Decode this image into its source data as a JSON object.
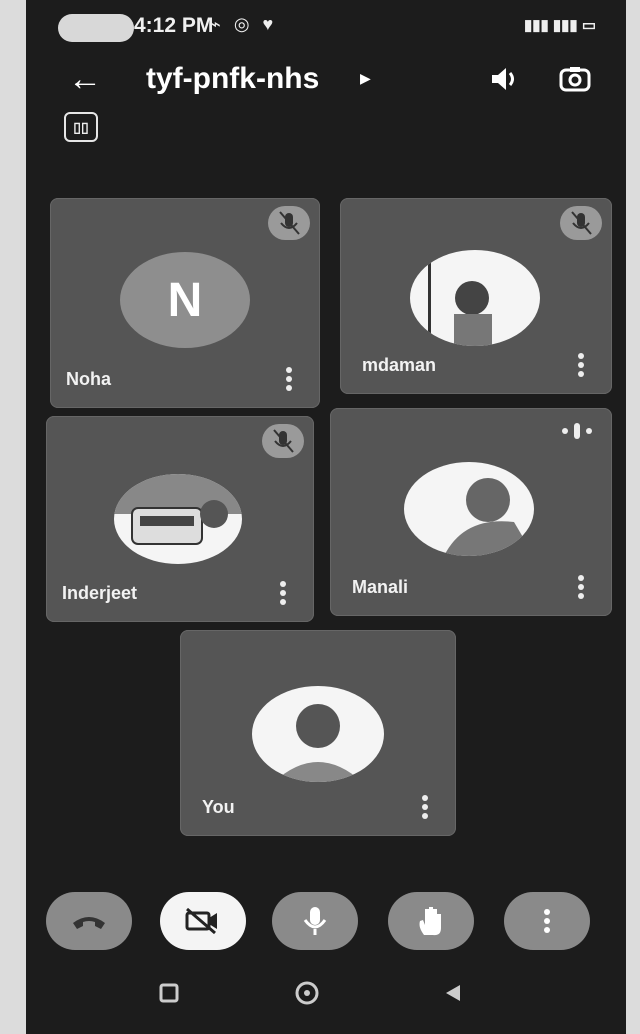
{
  "status_bar": {
    "time": "4:12 PM"
  },
  "header": {
    "meeting_code": "tyf-pnfk-nhs"
  },
  "participants": [
    {
      "name": "Noha",
      "initial": "N",
      "muted": true
    },
    {
      "name": "mdaman",
      "muted": true
    },
    {
      "name": "Inderjeet",
      "muted": true
    },
    {
      "name": "Manali",
      "muted": false,
      "speaking": true
    },
    {
      "name": "You"
    }
  ],
  "controls": [
    "end-call",
    "camera-off",
    "microphone",
    "raise-hand",
    "more-options"
  ],
  "colors": {
    "background": "#1c1c1c",
    "tile": "#555555",
    "control": "#8a8a8a",
    "active_control": "#f4f4f4"
  }
}
